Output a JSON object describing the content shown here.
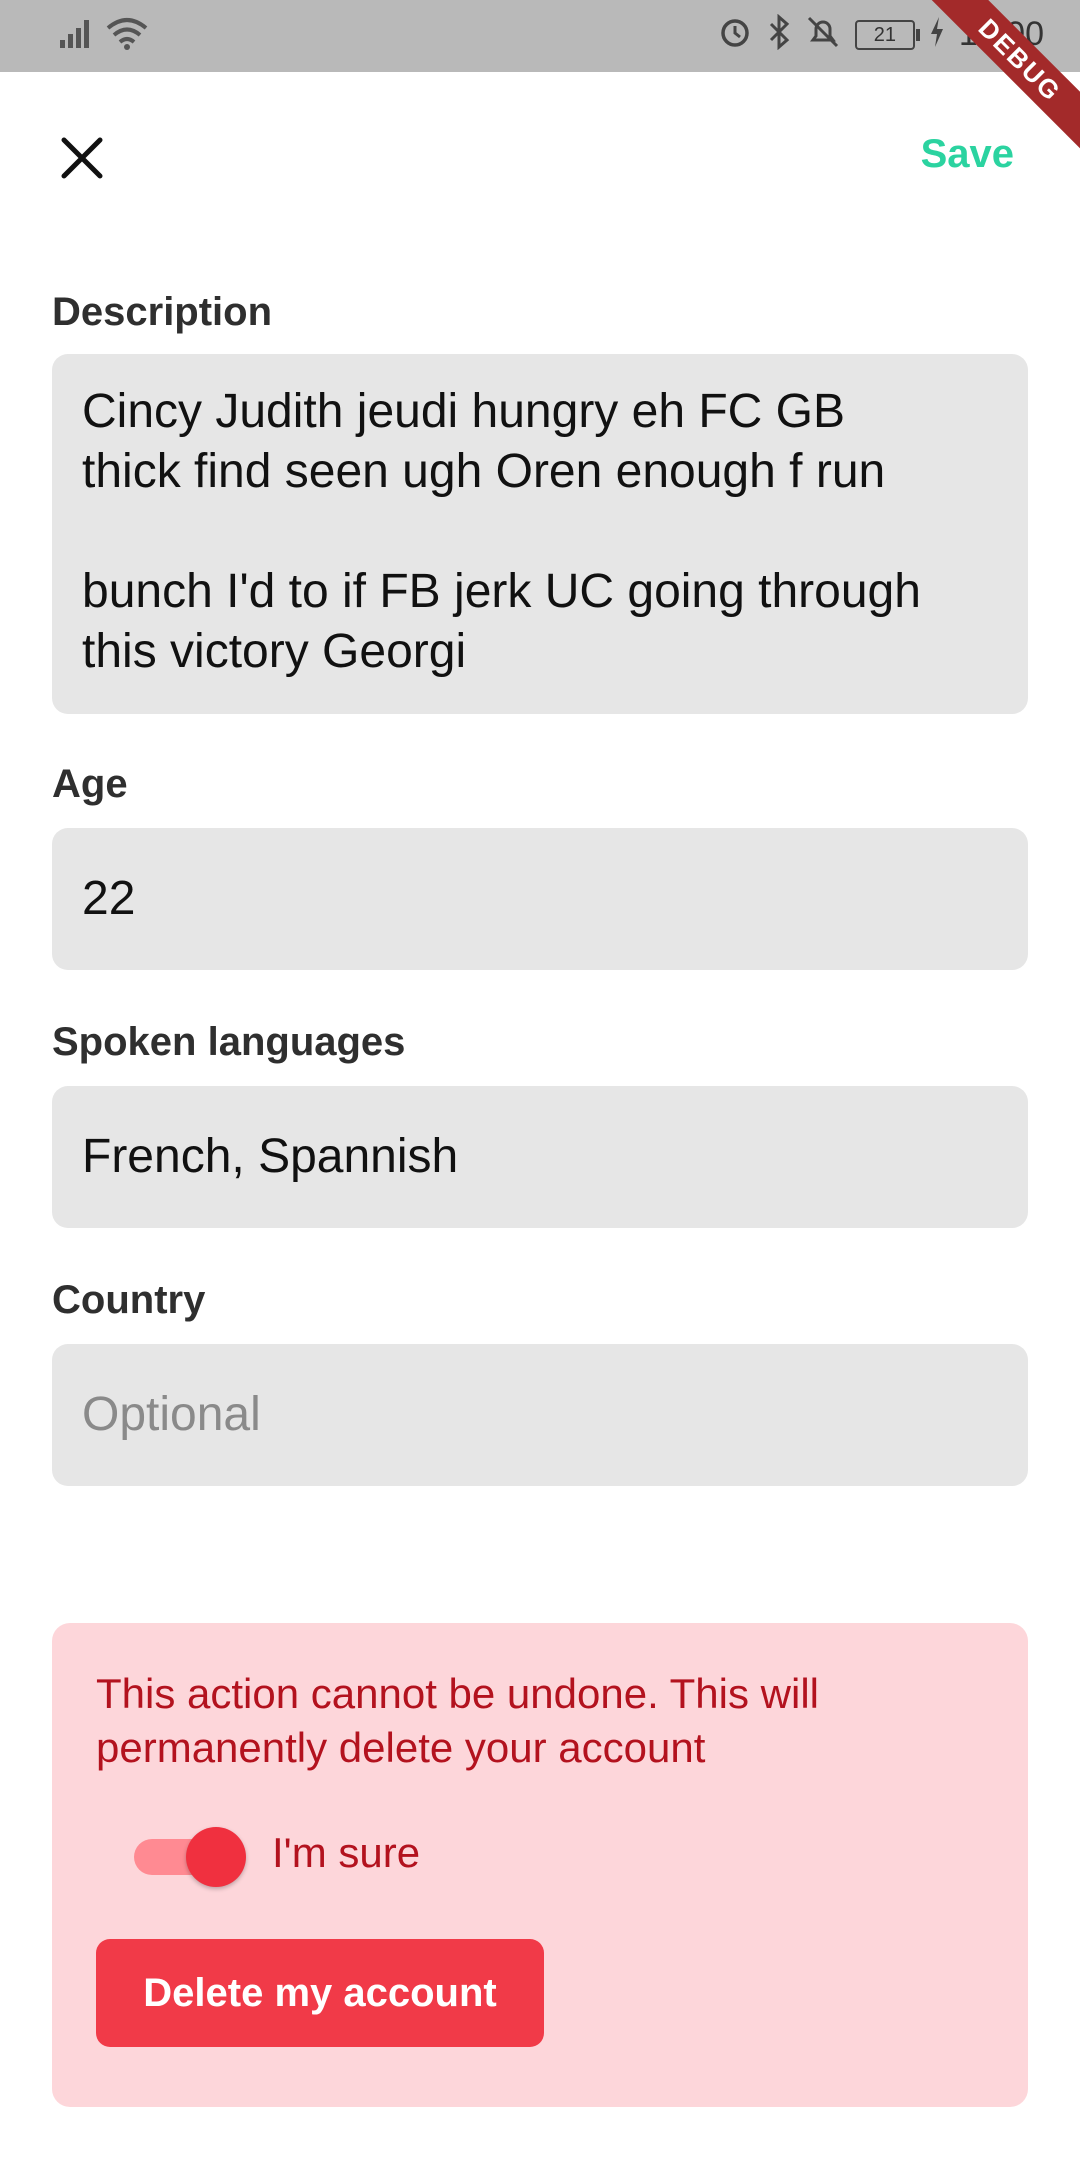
{
  "status_bar": {
    "time": "14:00",
    "battery": "21"
  },
  "debug_banner": "DEBUG",
  "app_bar": {
    "save_label": "Save"
  },
  "form": {
    "description": {
      "label": "Description",
      "value": "Cincy Judith jeudi hungry eh FC GB\nthick find seen ugh Oren enough f run\n\nbunch I'd to if FB jerk UC going through\nthis victory Georgi"
    },
    "age": {
      "label": "Age",
      "value": "22"
    },
    "languages": {
      "label": "Spoken languages",
      "value": "French, Spannish"
    },
    "country": {
      "label": "Country",
      "placeholder": "Optional",
      "value": ""
    }
  },
  "danger_zone": {
    "warning": "This action cannot be undone. This will permanently delete your account",
    "confirm_label": "I'm sure",
    "confirm_checked": true,
    "delete_label": "Delete my account"
  }
}
